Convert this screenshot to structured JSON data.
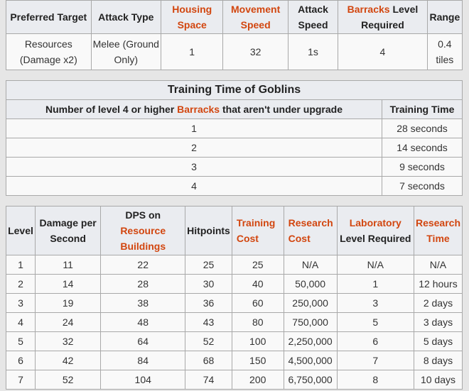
{
  "stats": {
    "headers": [
      {
        "text": "Preferred Target",
        "link": false
      },
      {
        "text": "Attack Type",
        "link": false
      },
      {
        "text": "Housing Space",
        "link": true
      },
      {
        "text": "Movement Speed",
        "link": true
      },
      {
        "text": "Attack Speed",
        "link": false
      },
      {
        "link_part": "Barracks",
        "rest": " Level Required"
      },
      {
        "text": "Range",
        "link": false
      }
    ],
    "row": [
      "Resources (Damage x2)",
      "Melee (Ground Only)",
      "1",
      "32",
      "1s",
      "4",
      "0.4 tiles"
    ]
  },
  "training": {
    "caption": "Training Time of Goblins",
    "col1_before": "Number of level 4 or higher ",
    "col1_link": "Barracks",
    "col1_after": " that aren't under upgrade",
    "col2": "Training Time",
    "rows": [
      [
        "1",
        "28 seconds"
      ],
      [
        "2",
        "14 seconds"
      ],
      [
        "3",
        "9 seconds"
      ],
      [
        "4",
        "7 seconds"
      ]
    ]
  },
  "levels": {
    "headers": {
      "level": "Level",
      "dps": "Damage per Second",
      "dps_res_top": "DPS on",
      "dps_res_link": "Resource Buildings",
      "hitpoints": "Hitpoints",
      "training_cost": "Training Cost",
      "research_cost": "Research Cost",
      "lab_link": "Laboratory",
      "lab_rest": "Level Required",
      "research_time": "Research Time"
    },
    "rows": [
      [
        "1",
        "11",
        "22",
        "25",
        "25",
        "N/A",
        "N/A",
        "N/A"
      ],
      [
        "2",
        "14",
        "28",
        "30",
        "40",
        "50,000",
        "1",
        "12 hours"
      ],
      [
        "3",
        "19",
        "38",
        "36",
        "60",
        "250,000",
        "3",
        "2 days"
      ],
      [
        "4",
        "24",
        "48",
        "43",
        "80",
        "750,000",
        "5",
        "3 days"
      ],
      [
        "5",
        "32",
        "64",
        "52",
        "100",
        "2,250,000",
        "6",
        "5 days"
      ],
      [
        "6",
        "42",
        "84",
        "68",
        "150",
        "4,500,000",
        "7",
        "8 days"
      ],
      [
        "7",
        "52",
        "104",
        "74",
        "200",
        "6,750,000",
        "8",
        "10 days"
      ]
    ]
  }
}
